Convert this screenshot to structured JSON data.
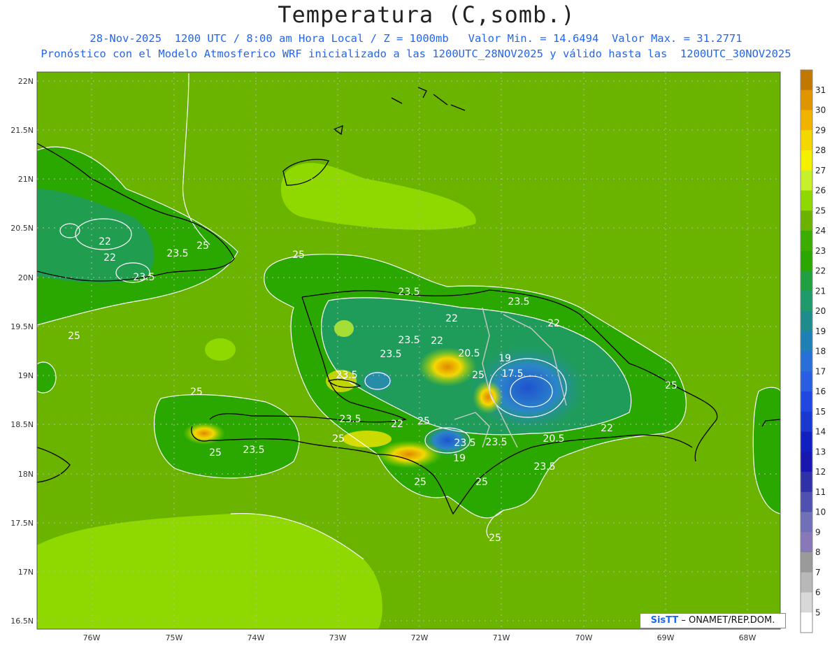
{
  "title": "Temperatura (C,somb.)",
  "subtitle_line1": "28-Nov-2025  1200 UTC / 8:00 am Hora Local / Z = 1000mb   Valor Min. = 14.6494  Valor Max. = 31.2771",
  "subtitle_line2": "Pronóstico con el Modelo Atmosferico WRF inicializado a las 1200UTC_28NOV2025 y válido hasta las  1200UTC_30NOV2025",
  "credit": {
    "brand": "SisTT",
    "text": "– ONAMET/REP.DOM."
  },
  "colors": {
    "ocean_green": "#6ab400",
    "light_green": "#8fd900",
    "land_green": "#2aa800",
    "teal": "#1f9a6a",
    "blue": "#2b7bd0",
    "yellow": "#f4e600",
    "orange": "#e8a800",
    "contour": "#ffffff"
  },
  "map": {
    "lat_labels": [
      "22N",
      "21.5N",
      "21N",
      "20.5N",
      "20N",
      "19.5N",
      "19N",
      "18.5N",
      "18N",
      "17.5N",
      "17N",
      "16.5N"
    ],
    "lon_labels": [
      "76W",
      "75W",
      "74W",
      "73W",
      "72W",
      "71W",
      "70W",
      "69W",
      "68W"
    ]
  },
  "contour_labels": [
    {
      "text": "22"
    },
    {
      "text": "22"
    },
    {
      "text": "23.5"
    },
    {
      "text": "25"
    },
    {
      "text": "23.5"
    },
    {
      "text": "25"
    },
    {
      "text": "25"
    },
    {
      "text": "23.5"
    },
    {
      "text": "23.5"
    },
    {
      "text": "22"
    },
    {
      "text": "22"
    },
    {
      "text": "23.5"
    },
    {
      "text": "22"
    },
    {
      "text": "20.5"
    },
    {
      "text": "23.5"
    },
    {
      "text": "19"
    },
    {
      "text": "17.5"
    },
    {
      "text": "25"
    },
    {
      "text": "25"
    },
    {
      "text": "23.5"
    },
    {
      "text": "25"
    },
    {
      "text": "25"
    },
    {
      "text": "23.5"
    },
    {
      "text": "25"
    },
    {
      "text": "23.5"
    },
    {
      "text": "22"
    },
    {
      "text": "25"
    },
    {
      "text": "23.5"
    },
    {
      "text": "23.5"
    },
    {
      "text": "19"
    },
    {
      "text": "20.5"
    },
    {
      "text": "22"
    },
    {
      "text": "23.5"
    },
    {
      "text": "25"
    },
    {
      "text": "25"
    },
    {
      "text": "25"
    }
  ],
  "legend": {
    "levels": [
      31,
      30,
      29,
      28,
      27,
      26,
      25,
      24,
      23,
      22,
      21,
      20,
      19,
      18,
      17,
      16,
      15,
      14,
      13,
      12,
      11,
      10,
      9,
      8,
      7,
      6,
      5
    ],
    "colors": [
      "#c07800",
      "#e09400",
      "#f0b400",
      "#f4d600",
      "#f4f000",
      "#c8f02a",
      "#8fd900",
      "#6ab400",
      "#3cac00",
      "#2aa800",
      "#20a040",
      "#1f9a6a",
      "#1e8c8c",
      "#1e80b4",
      "#2870d8",
      "#2a5ee0",
      "#2048e0",
      "#1838d0",
      "#1020c0",
      "#1818b0",
      "#3030a8",
      "#5050b0",
      "#7070b8",
      "#8878b8",
      "#9a9a9a",
      "#b8b8b8",
      "#d8d8d8",
      "#ffffff"
    ]
  }
}
